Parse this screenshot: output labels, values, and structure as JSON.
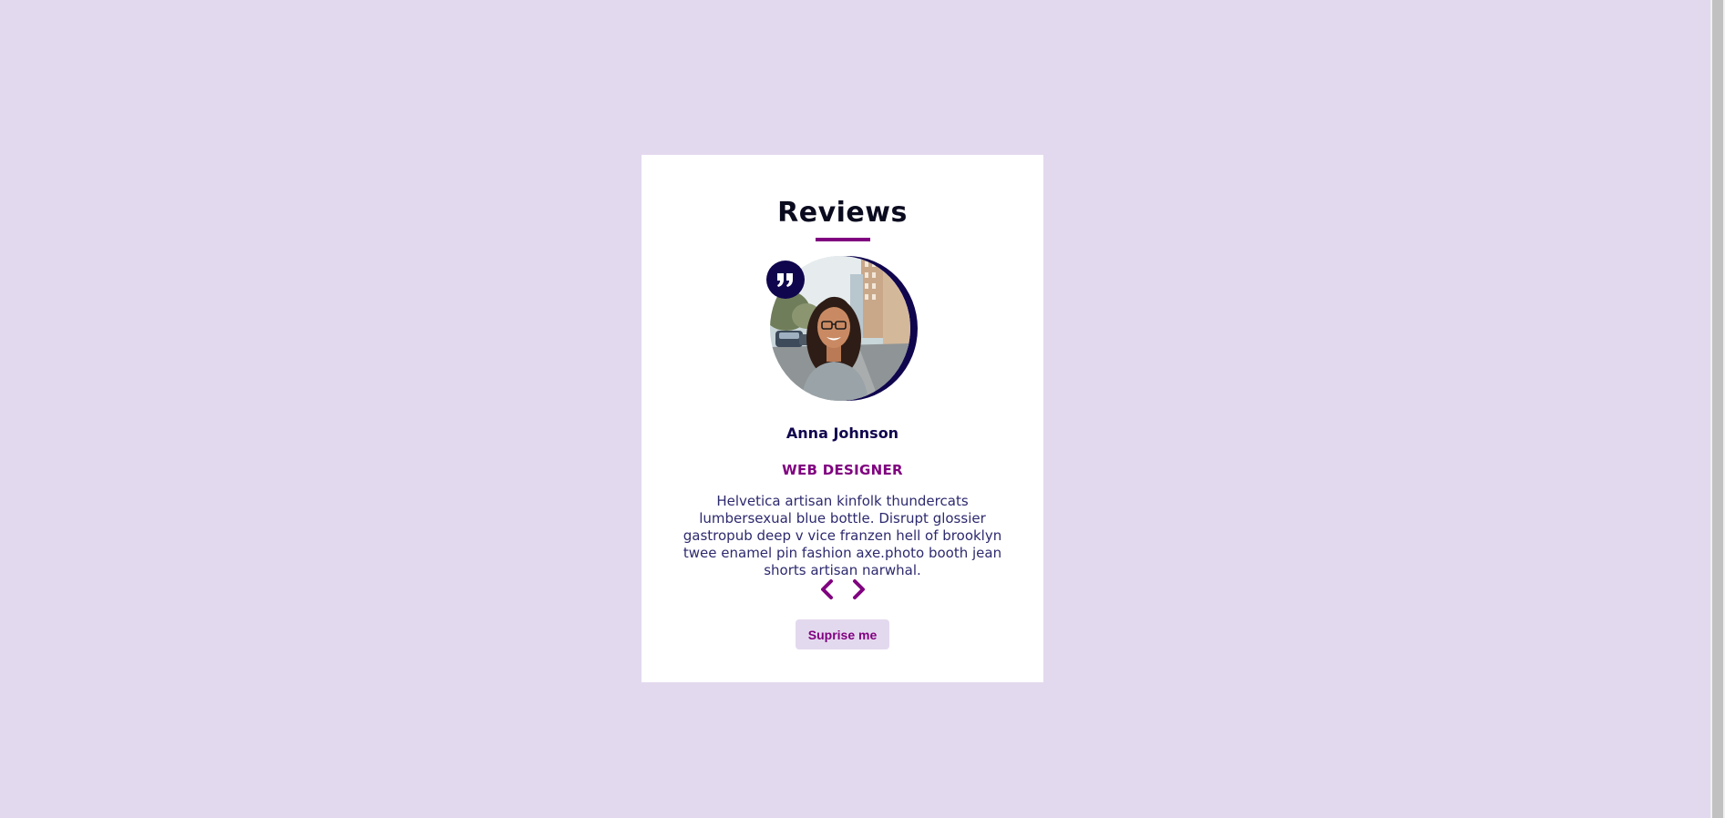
{
  "review": {
    "heading": "Reviews",
    "author": "Anna Johnson",
    "job": "WEB DESIGNER",
    "info": "Helvetica artisan kinfolk thundercats lumbersexual blue bottle. Disrupt glossier gastropub deep v vice franzen hell of brooklyn twee enamel pin fashion axe.photo booth jean shorts artisan narwhal.",
    "photo_icon": "person-photo",
    "quote_icon": "quote-right-icon",
    "prev_icon": "chevron-left-icon",
    "next_icon": "chevron-right-icon",
    "random_label": "Suprise me"
  },
  "colors": {
    "background": "#e3d9ee",
    "card": "#ffffff",
    "accent": "#800080",
    "dark_navy": "#10064e",
    "text": "#2d2a6e"
  }
}
